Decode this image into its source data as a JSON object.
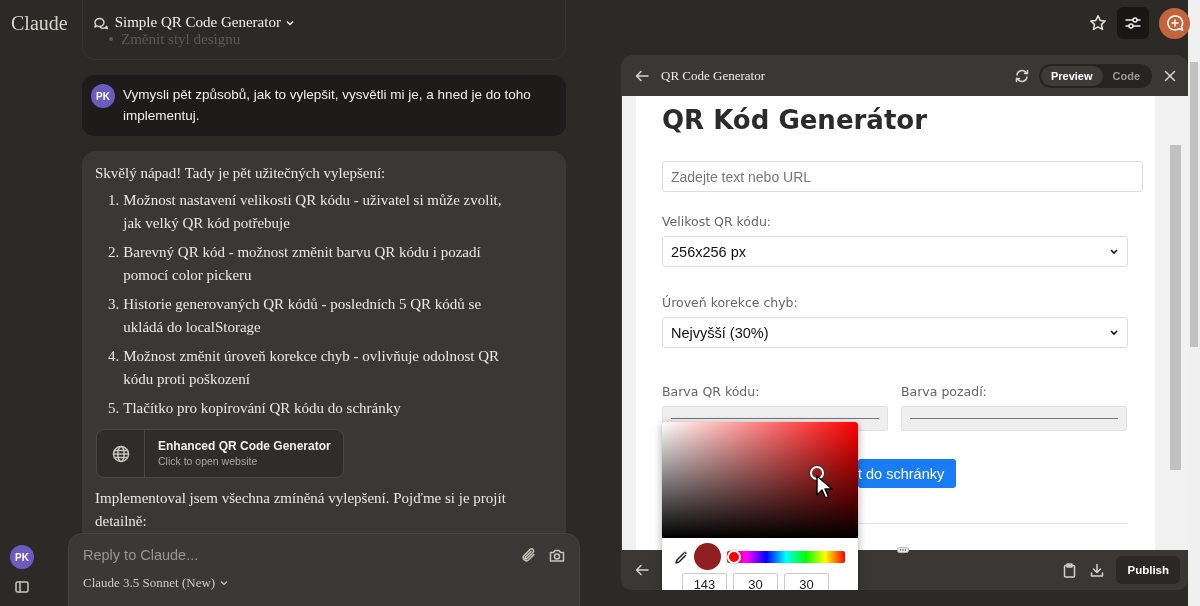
{
  "header": {
    "logo": "Claude",
    "title": "Simple QR Code Generator"
  },
  "chat": {
    "previous_fragment": "Změnit styl designu",
    "user_message": {
      "avatar": "PK",
      "text": "Vymysli pět způsobů, jak to vylepšit, vysvětli mi je, a hned je do toho implementuj."
    },
    "assistant_message": {
      "intro": "Skvělý nápad! Tady je pět užitečných vylepšení:",
      "items": [
        {
          "number": "1.",
          "text": "Možnost nastavení velikosti QR kódu - uživatel si může zvolit, jak velký QR kód potřebuje"
        },
        {
          "number": "2.",
          "text": "Barevný QR kód - možnost změnit barvu QR kódu i pozadí pomocí color pickeru"
        },
        {
          "number": "3.",
          "text": "Historie generovaných QR kódů - posledních 5 QR kódů se ukládá do localStorage"
        },
        {
          "number": "4.",
          "text": "Možnost změnit úroveň korekce chyb - ovlivňuje odolnost QR kódu proti poškození"
        },
        {
          "number": "5.",
          "text": "Tlačítko pro kopírování QR kódu do schránky"
        }
      ],
      "artifact_card": {
        "title": "Enhanced QR Code Generator",
        "subtitle": "Click to open website"
      },
      "outro": "Implementoval jsem všechna zmíněná vylepšení. Pojďme si je projít detailně:"
    }
  },
  "composer": {
    "placeholder": "Reply to Claude...",
    "model": "Claude 3.5 Sonnet (New)"
  },
  "sidebar": {
    "avatar": "PK"
  },
  "artifact": {
    "title": "QR Code Generator",
    "tabs": [
      {
        "label": "Preview",
        "selected": true
      },
      {
        "label": "Code",
        "selected": false
      }
    ],
    "preview": {
      "heading": "QR Kód Generátor",
      "text_input": {
        "placeholder": "Zadejte text nebo URL"
      },
      "size": {
        "label": "Velikost QR kódu:",
        "value": "256x256 px"
      },
      "error_correction": {
        "label": "Úroveň korekce chyb:",
        "value": "Nejvyšší (30%)"
      },
      "colors": [
        {
          "label": "Barva QR kódu:"
        },
        {
          "label": "Barva pozadí:"
        }
      ],
      "copy_button": "t do schránky"
    },
    "color_picker": {
      "hue": {
        "level": 0
      },
      "rgb": [
        "143",
        "30",
        "30"
      ]
    },
    "publish_button": "Publish"
  }
}
